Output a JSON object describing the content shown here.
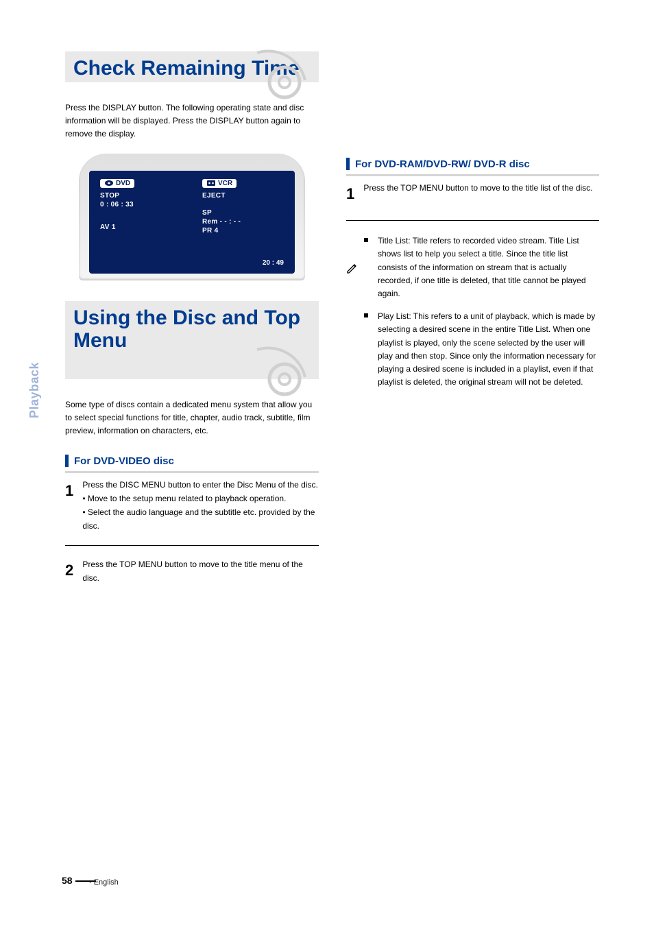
{
  "sidebar_label": "Playback",
  "page_number": "58",
  "footer": "- English",
  "left": {
    "title1": "Check Remaining Time",
    "screen": {
      "dvd_label": "DVD",
      "stop": "STOP",
      "time": "0 : 06 : 33",
      "av": "AV 1",
      "vcr_label": "VCR",
      "eject": "EJECT",
      "sp": "SP",
      "rem": "Rem - - : - -",
      "pr": "PR   4",
      "clock": "20 : 49"
    },
    "intro": "Press the DISPLAY button. The following operating state and disc information will be displayed. Press the DISPLAY button again to remove the display.",
    "title2": "Using the Disc and Top Menu",
    "intro2": "Some type of discs contain a dedicated menu system that allow you to select special functions for title, chapter, audio track, subtitle, film preview, information on characters, etc.",
    "sub_video": "For DVD-VIDEO disc",
    "step1_num": "1",
    "step1": "Press the DISC MENU button to enter the Disc Menu of the disc.",
    "step1_b1": "Move to the setup menu related to playback operation.",
    "step1_b2": "Select the audio language and the subtitle etc. provided by the disc.",
    "step2_num": "2",
    "step2": "Press the TOP MENU button to move to the title menu of the disc."
  },
  "right": {
    "sub_ram": "For DVD-RAM/DVD-RW/ DVD-R disc",
    "step1_num": "1",
    "step1": "Press the TOP MENU button to move to the title list of the disc.",
    "note1": "Title List: Title refers to recorded video stream. Title List shows list to help you select a title. Since the title list consists of the information on stream that is actually recorded, if one title is deleted, that title cannot be played again.",
    "note2": "Play List: This refers to a unit of playback, which is made by selecting a desired scene in the entire Title List. When one playlist is played, only the scene selected by the user will play and then stop. Since only the information necessary for playing a desired scene is included in a playlist, even if that playlist is deleted, the original stream will not be deleted."
  }
}
